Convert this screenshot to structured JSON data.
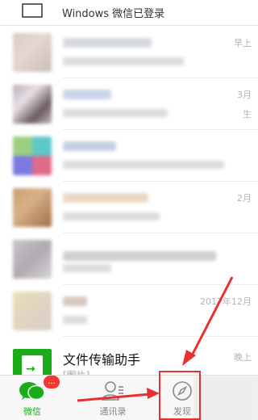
{
  "banner": {
    "text": "Windows 微信已登录",
    "icon": "pc-monitor-icon"
  },
  "chats": [
    {
      "time": "早上",
      "time_extra": ""
    },
    {
      "time": "3月",
      "time_extra": "生"
    },
    {
      "time": "",
      "time_extra": ""
    },
    {
      "time": "2月",
      "time_extra": ""
    },
    {
      "time": "",
      "time_extra": ""
    },
    {
      "time": "2017年12月",
      "time_extra": ""
    }
  ],
  "file_transfer": {
    "name": "文件传输助手",
    "subtitle": "[图片]",
    "time": "晚上",
    "icon": "file-transfer-icon"
  },
  "tabbar": {
    "tabs": [
      {
        "label": "微信",
        "icon": "chat-bubbles-icon",
        "active": true,
        "badge": "…"
      },
      {
        "label": "通讯录",
        "icon": "contacts-icon",
        "active": false
      },
      {
        "label": "发现",
        "icon": "compass-icon",
        "active": false
      },
      {
        "label": "",
        "icon": "me-icon",
        "active": false
      }
    ]
  },
  "colors": {
    "accent": "#1aad19",
    "badge": "#f43530",
    "annotation": "#e83030"
  }
}
